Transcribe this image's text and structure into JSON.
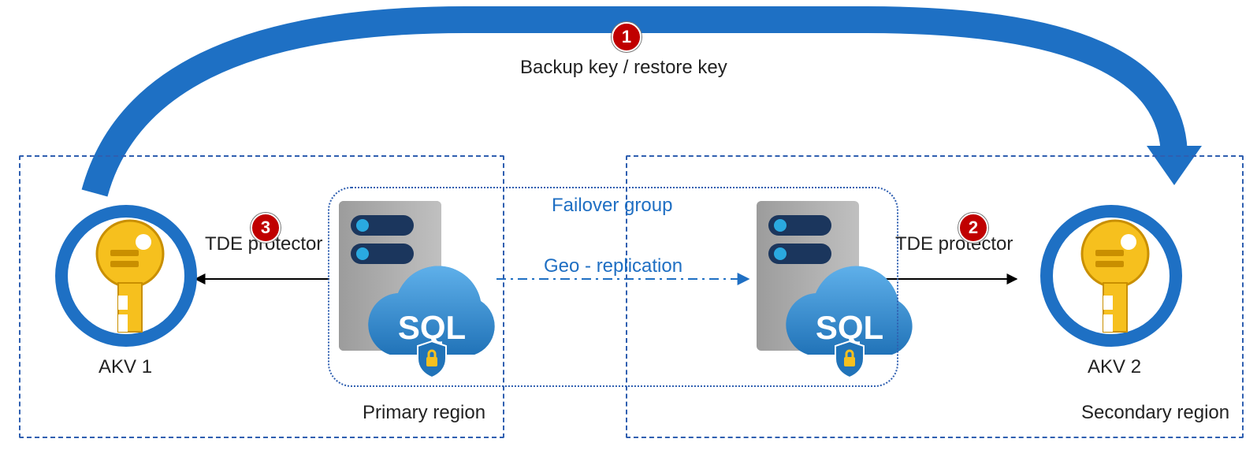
{
  "backup_restore_label": "Backup key / restore key",
  "failover_label": "Failover group",
  "geo_repl_label": "Geo - replication",
  "primary": {
    "akv_label": "AKV 1",
    "region_label": "Primary region",
    "tde_label": "TDE protector"
  },
  "secondary": {
    "akv_label": "AKV 2",
    "region_label": "Secondary region",
    "tde_label": "TDE protector"
  },
  "badges": {
    "one": "1",
    "two": "2",
    "three": "3"
  },
  "colors": {
    "dashed_blue": "#2f5fb0",
    "arrow_blue": "#1e70c4",
    "badge_red": "#c00000",
    "key_yellow": "#f6c01e",
    "sql_blue": "#3b95d8"
  }
}
